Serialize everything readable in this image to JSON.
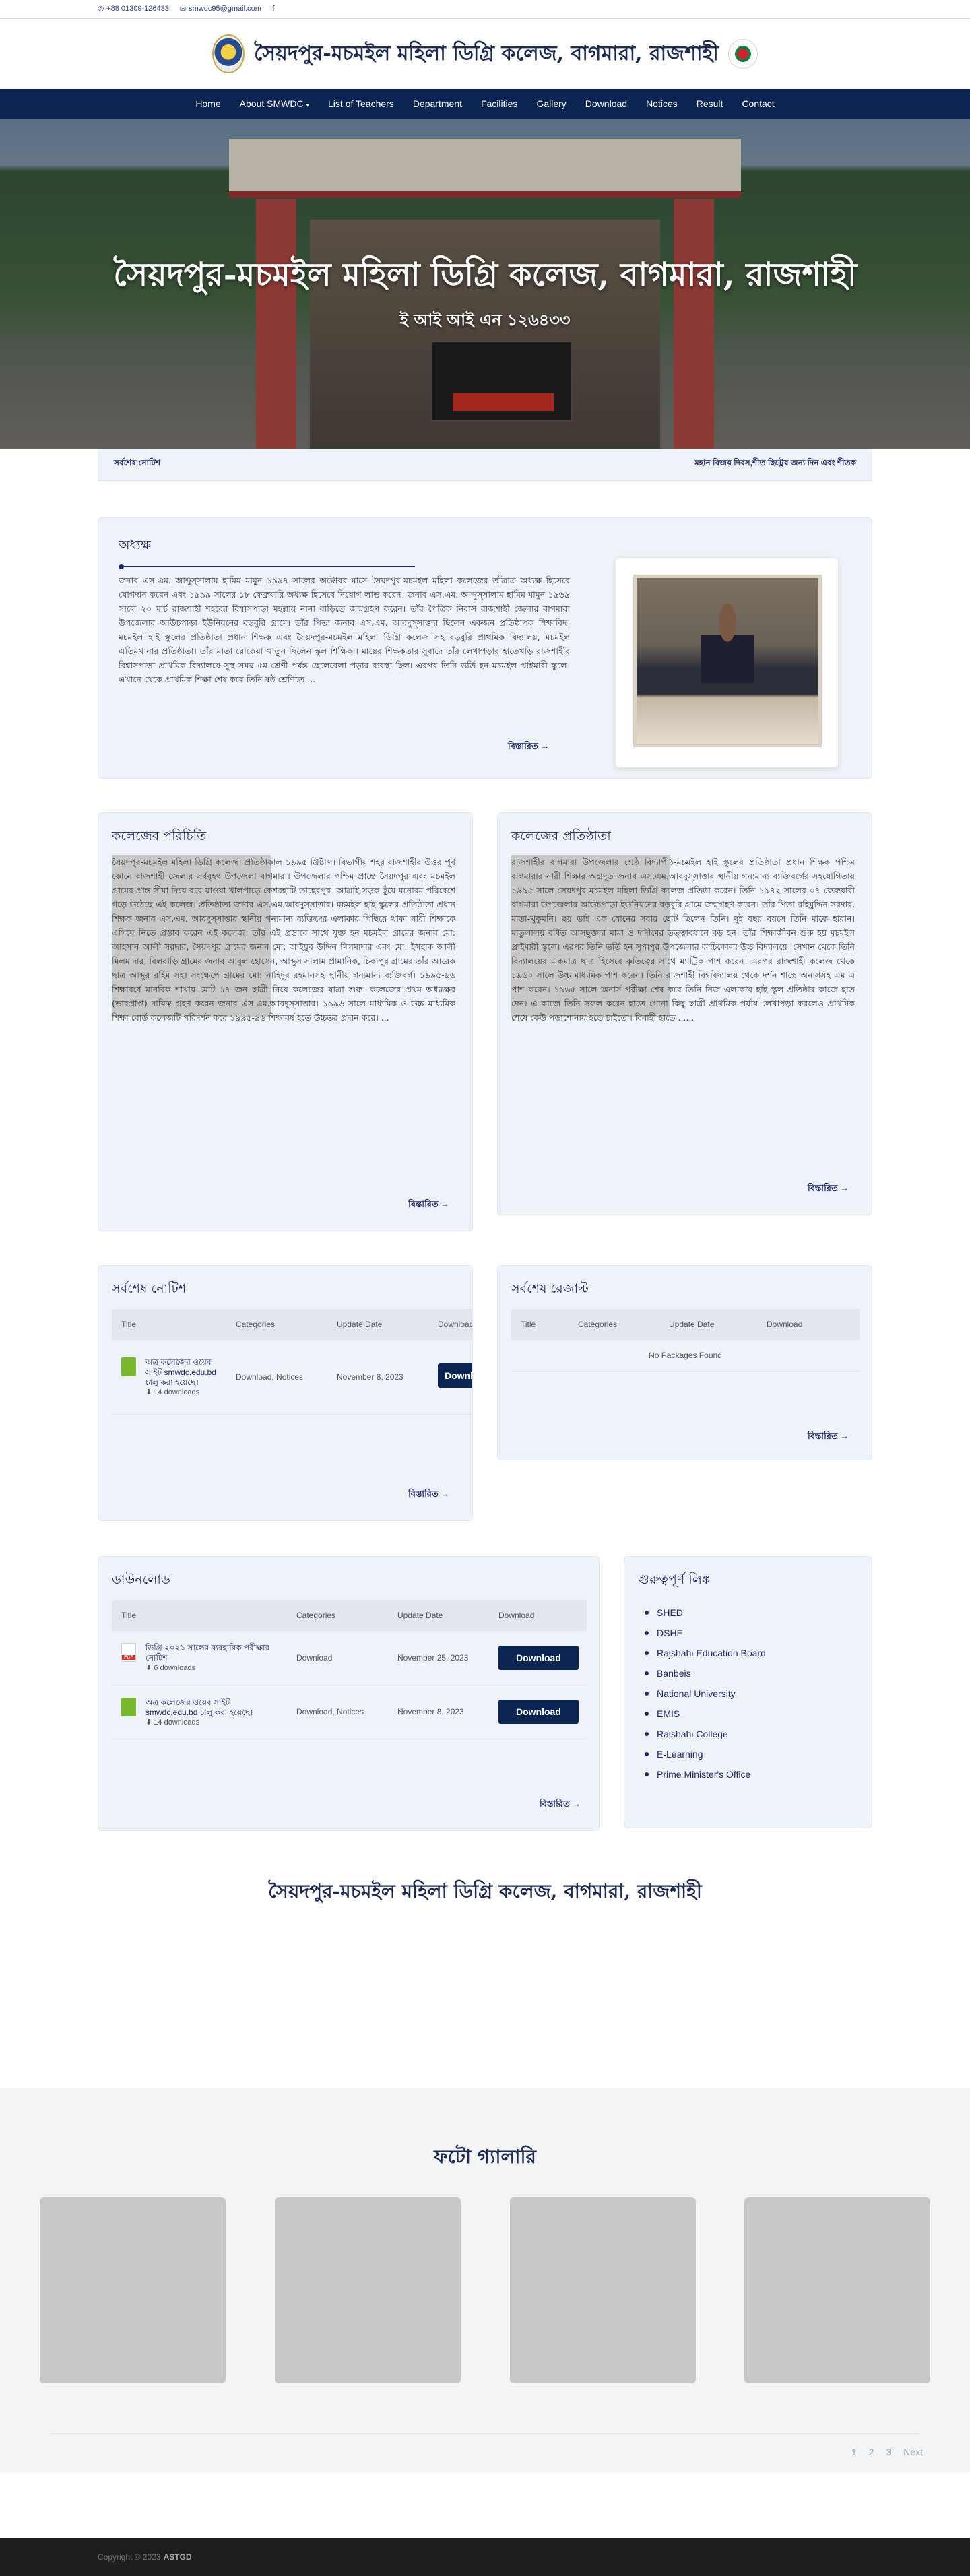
{
  "topbar": {
    "phone": "+88 01309-126433",
    "email": "smwdc95@gmail.com",
    "facebook_icon": "facebook-icon"
  },
  "brand": {
    "title": "সৈয়দপুর-মচমইল মহিলা ডিগ্রি কলেজ, বাগমারা, রাজশাহী"
  },
  "nav": {
    "items": [
      "Home",
      "About SMWDC",
      "List of Teachers",
      "Department",
      "Facilities",
      "Gallery",
      "Download",
      "Notices",
      "Result",
      "Contact"
    ]
  },
  "hero": {
    "title": "সৈয়দপুর-মচমইল মহিলা ডিগ্রি কলেজ, বাগমারা, রাজশাহী",
    "subtitle": "ই আই আই এন ১২৬৪৩৩"
  },
  "ticker": {
    "label": "সর্বশেষ নোটিশ",
    "text": "মহান বিজয় দিবস,শীত ছিট্রের জন্য দিন এবং শীতক"
  },
  "principal": {
    "heading": "অধ্যক্ষ",
    "text": "জনাব এস.এম. আব্দুস্সালাম হামিম মামুন ১৯৯৭ সালের অক্টোবর মাসে সৈয়দপুর-মচমইল মহিলা কলেজের তাঁত্রাত্র অধ্যক্ষ হিসেবে যোগদান করেন এবং ১৯৯৯ সালের ১৮ ফেব্রুয়ারি অধ্যক্ষ হিসেবে নিয়োগ লাভ করেন। জনাব এস.এম. আব্দুস্সালাম হামিম মামুন ১৯৬৯ সালে ২০ মার্চ রাজশাহী শহরের বিশ্বাসপাড়া মহল্লায় নানা বাড়িতে জন্মগ্রহণ করেন। তাঁর পৈত্রিক নিবাস রাজশাহী জেলার বাগমারা উপজেলার আউচপাড়া ইউনিয়নের বড়বুরি গ্রামে। তাঁর পিতা জনাব এস.এম. আবদুস্সাত্তার ছিলেন একজন প্রতিষ্ঠাপক শিক্ষাবিদ। মচমইল হাই স্কুলের প্রতিষ্ঠাতা প্রধান শিক্ষক এবং সৈয়দপুর-মচমইল মহিলা ডিগ্রি কলেজ সহ বড়বুরি প্রাথমিক বিদ্যালয়, মচমইল এতিমখানার প্রতিষ্ঠাতা। তাঁর মাতা রোকেয়া খাতুন ছিলেন স্কুল শিক্ষিকা। মায়ের শিক্ষকতার সুবাদে তাঁর লেখাপড়ার হাতেখড়ি রাজশাহীর বিশ্বাসপাড়া প্রাথমিক বিদ্যালয়ে সুস্থ সময় ৫ম শ্রেণী পর্যন্ত ছেলেবেলা পড়ার ব্যবস্থা ছিল। এরপর তিনি ভর্তি হন মচমইল প্রাইমারী স্কুলে। এখানে থেকে প্রাথমিক শিক্ষা শেষ করে তিনি ষষ্ঠ শ্রেণিতে ...",
    "more": "বিস্তারিত →"
  },
  "intro": {
    "heading": "কলেজের পরিচিতি",
    "text": "সৈয়দপুর-মচমইল মহিলা ডিগ্রি কলেজ। প্রতিষ্ঠাকাল ১৯৯৫ খ্রিষ্টাব্দ। বিভাগীয় শহর রাজশাহীর উত্তর পূর্ব কোনে রাজশাহী জেলার সর্ববৃহৎ উপজেলা বাগমারা। উপজেলার পশ্চিম প্রান্তে সৈয়দপুর এবং মচমইল গ্রামের প্রান্ত সীমা দিয়ে বয়ে যাওয়া খালপাড়ে কেশরহাটি-তাহেরপুর- আত্রাই সড়ক ছুঁয়ে মনোরম পরিবেশে গড়ে উঠেছে এই কলেজ। প্রতিষ্ঠাতা জনাব এস.এম.আবদুস্সাত্তার। মচমইল হাই স্কুলের প্রতিষ্ঠাতা প্রধান শিক্ষক জনাব এস.এম. আবদুস্সাত্তার স্থানীয় গন্যমান্য ব্যক্তিদের এলাকার পিছিয়ে থাকা নারী শিক্ষাকে এগিয়ে নিতে প্রস্তাব করেন এই কলেজ। তাঁর এই প্রস্তাবে সাথে যুক্ত হন মচমইল গ্রামের জনাব মো: আহসান আলী সরদার, সৈয়দপুর গ্রামের জনাব মো: আইয়ুব উদ্দিন মিলমাদার এবং মো: ইসহাক আলী মিলমাদার, বিলবাড়ি গ্রামের জনাব আবুল হোসেন, আব্দুস সালাম প্রামানিক, চিকাপুর গ্রামের তাঁর আরেক ছাত্র আব্দুর রহিম সহ। সংক্ষেপে গ্রামের মো: নাহিদুর রহমানসহ স্থানীয় গন্যমান্য ব্যক্তিবর্গ। ১৯৯৫-৯৬ শিক্ষাবর্ষে মানবিক শাখায় মোট ১৭ জন ছাত্রী নিয়ে কলেজের যাত্রা শুরু। কলেজের প্রথম অধ্যক্ষের (ভারপ্রাপ্ত) দায়িত্ব গ্রহণ করেন জনাব এস.এম.আবদুস্সাত্তার। ১৯৯৬ সালে মাধ্যমিক ও উচ্চ মাধ্যমিক শিক্ষা বোর্ড কলেজটি পরিদর্শন করে ১৯৯৫-৯৬ শিক্ষাবর্ষ হতে উচ্চতর প্রদান করে। ...",
    "more": "বিস্তারিত →"
  },
  "founder": {
    "heading": "কলেজের প্রতিষ্ঠাতা",
    "text": "রাজশাহীর বাগমারা উপজেলার শ্রেষ্ঠ বিদ্যাপীঠ-মচমইল হাই স্কুলের প্রতিষ্ঠাতা প্রধান শিক্ষক পশ্চিম বাগমারার নারী শিক্ষার অগ্রদূত জনাব এস.এম.আবদুস্সাত্তার স্থানীয় গন্যমান্য ব্যক্তিবর্গের সহযোগিতায় ১৯৯৫ সালে সৈয়দপুর-মচমইল মহিলা ডিগ্রি কলেজ প্রতিষ্ঠা করেন। তিনি ১৯৪২ সালের ০৭ ফেব্রুয়ারী বাগমারা উপজেলার আউচপাড়া ইউনিয়নের বড়বুরি গ্রামে জন্মগ্রহণ করেন। তাঁর পিতা-রহিমুদ্দিন সরদার, মাতা-খুকুমনি। ছয় ভাই এক বোনের সবার ছোট ছিলেন তিনি। দুই বছর বয়সে তিনি মাকে হারান। মাতুলালয় বর্ধিত আসছুক্তার মামা ও দাদীমের তত্ত্বাবধানে বড় হন। তাঁর শিক্ষাজীবন শুরু হয় মচমইল প্রাইমারী স্কুলে। এরপর তিনি ভর্তি হন সুপাপুর উপজেলার কাচিকোলা উচ্চ বিদ্যালয়ে। সেখান থেকে তিনি বিদ্যালয়ের একমাত্র ছাত্র হিসেবে কৃতিত্বের সাথে ম্যাট্রিক পাশ করেন। এরপর রাজশাহী কলেজ থেকে ১৯৬০ সালে উচ্চ মাধ্যমিক পাশ করেন। তিনি রাজশাহী বিশ্ববিদ্যালয় থেকে দর্শন শাস্ত্রে অনার্সসহ এম এ পাশ করেন। ১৯৬৫ সালে অনার্স পরীক্ষা শেষ করে তিনি নিজ এলাকায় হাই স্কুল প্রতিষ্ঠার কাজে হাত দেন। এ কাজে তিনি সফল করেন হাতে গোনা কিছু ছাত্রী প্রাথমিক পর্যায় লেখাপড়া করলেও প্রাথমিক শেষে কেউ পড়াশোনায় হতে চাইতো। বিবাহী হাতে ......",
    "more": "বিস্তারিত →"
  },
  "notices": {
    "heading": "সর্বশেষ নোটিশ",
    "columns": [
      "Title",
      "Categories",
      "Update Date",
      "Download"
    ],
    "rows": [
      {
        "title": "অত্র কলেজের ওয়েব সাইট smwdc.edu.bd চালু করা হয়েছে।",
        "downloads": "14 downloads",
        "categories": "Download, Notices",
        "date": "November 8, 2023",
        "button": "Download"
      }
    ],
    "more": "বিস্তারিত →"
  },
  "results": {
    "heading": "সর্বশেষ রেজাল্ট",
    "columns": [
      "Title",
      "Categories",
      "Update Date",
      "Download"
    ],
    "empty": "No Packages Found",
    "more": "বিস্তারিত →"
  },
  "downloads": {
    "heading": "ডাউনলোড",
    "columns": [
      "Title",
      "Categories",
      "Update Date",
      "Download"
    ],
    "rows": [
      {
        "title": "ডিগ্রি ২০২১ সালের ব্যবহারিক পরীক্ষার নোটিশ",
        "downloads": "6 downloads",
        "categories": "Download",
        "date": "November 25, 2023",
        "button": "Download",
        "type": "pdf"
      },
      {
        "title": "অত্র কলেজের ওয়েব সাইট smwdc.edu.bd চালু করা হয়েছে।",
        "downloads": "14 downloads",
        "categories": "Download, Notices",
        "date": "November 8, 2023",
        "button": "Download",
        "type": "file"
      }
    ],
    "more": "বিস্তারিত →"
  },
  "important_links": {
    "heading": "গুরুত্বপূর্ণ লিঙ্ক",
    "items": [
      "SHED",
      "DSHE",
      "Rajshahi Education Board",
      "Banbeis",
      "National University",
      "EMIS",
      "Rajshahi College",
      "E-Learning",
      "Prime Minister's Office"
    ]
  },
  "footer_title": "সৈয়দপুর-মচমইল মহিলা ডিগ্রি কলেজ, বাগমারা, রাজশাহী",
  "gallery": {
    "heading": "ফটো গ্যালারি",
    "pages": [
      "1",
      "2",
      "3",
      "Next"
    ]
  },
  "footer": {
    "copyright": "Copyright © 2023",
    "company": "ASTGD"
  }
}
